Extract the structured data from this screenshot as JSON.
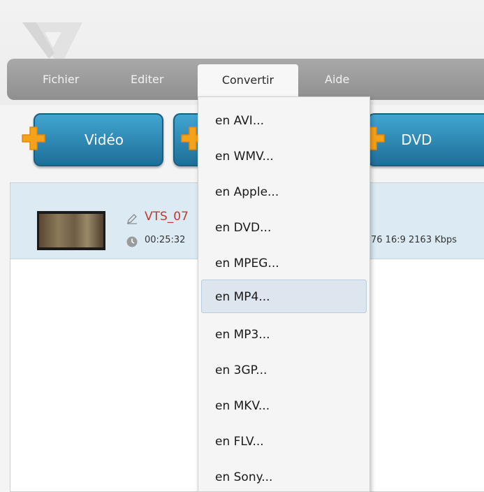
{
  "menu": {
    "items": [
      {
        "label": "Fichier"
      },
      {
        "label": "Editer"
      },
      {
        "label": "Convertir"
      },
      {
        "label": "Aide"
      }
    ]
  },
  "toolbar": {
    "video_label": "Vidéo",
    "dvd_label": "DVD"
  },
  "file": {
    "name": "VTS_07",
    "duration": "00:25:32",
    "specs": "76  16:9  2163 Kbps"
  },
  "dropdown": {
    "items": [
      "en AVI...",
      "en WMV...",
      "en Apple...",
      "en DVD...",
      "en MPEG...",
      "en MP4...",
      "en MP3...",
      "en 3GP...",
      "en MKV...",
      "en FLV...",
      "en Sony..."
    ],
    "selected_index": 5
  },
  "colors": {
    "accent": "#2a86b5",
    "plus_orange": "#f5a21b",
    "filename_red": "#c0392b",
    "selected_row": "#dbeaf3"
  },
  "icons": [
    "app-logo-icon",
    "plus-icon",
    "pencil-icon",
    "clock-icon"
  ]
}
